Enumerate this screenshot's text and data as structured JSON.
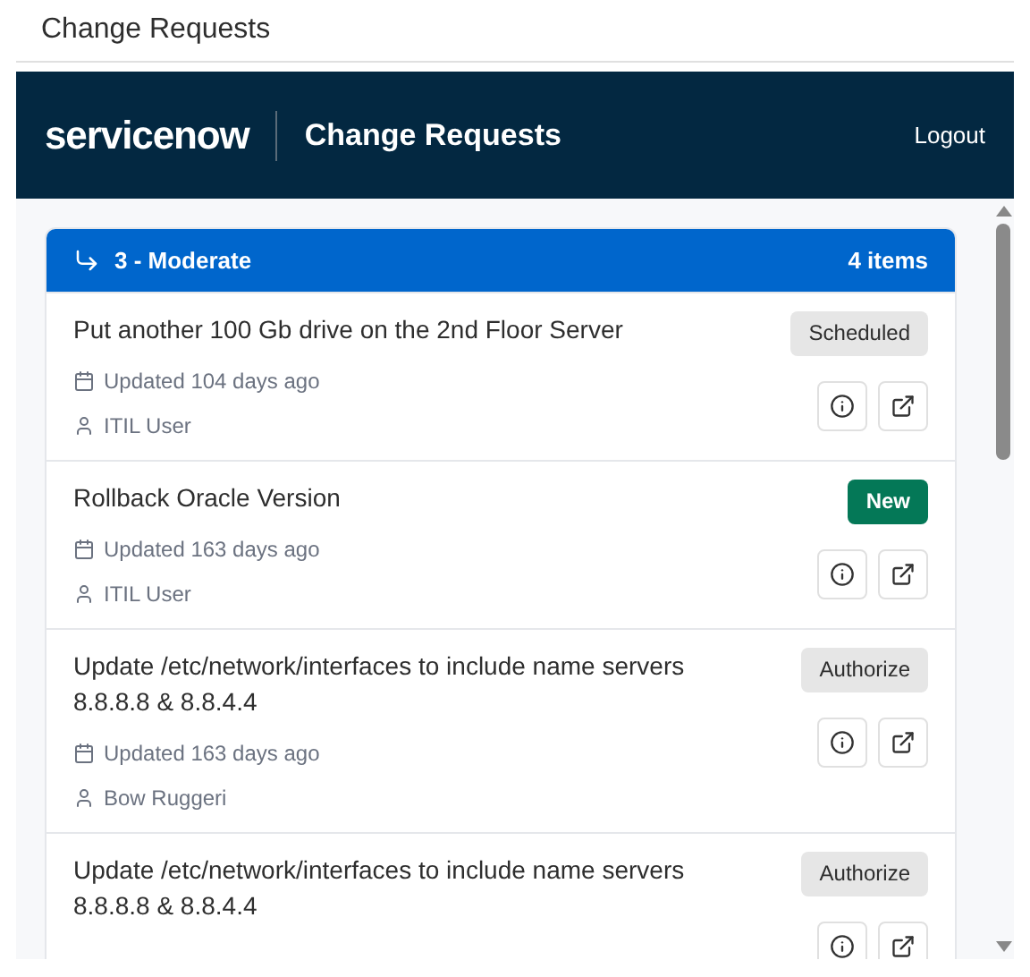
{
  "page_title": "Change Requests",
  "header": {
    "logo": "servicenow",
    "title": "Change Requests",
    "logout": "Logout"
  },
  "group": {
    "title": "3 - Moderate",
    "count": "4 items"
  },
  "items": [
    {
      "title": "Put another 100 Gb drive on the 2nd Floor Server",
      "status": {
        "label": "Scheduled",
        "kind": "neutral"
      },
      "updated": "Updated 104 days ago",
      "user": "ITIL User"
    },
    {
      "title": "Rollback Oracle Version",
      "status": {
        "label": "New",
        "kind": "success"
      },
      "updated": "Updated 163 days ago",
      "user": "ITIL User"
    },
    {
      "title": "Update /etc/network/interfaces to include name servers 8.8.8.8 & 8.8.4.4",
      "status": {
        "label": "Authorize",
        "kind": "neutral"
      },
      "updated": "Updated 163 days ago",
      "user": "Bow Ruggeri"
    },
    {
      "title": "Update /etc/network/interfaces to include name servers 8.8.8.8 & 8.8.4.4",
      "status": {
        "label": "Authorize",
        "kind": "neutral"
      }
    }
  ]
}
